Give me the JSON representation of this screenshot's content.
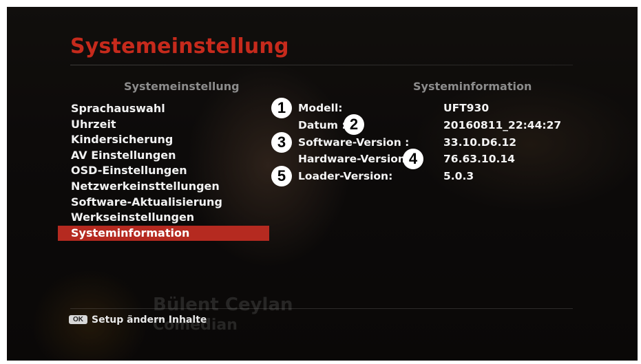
{
  "screen": {
    "title": "Systemeinstellung",
    "menu_header": "Systemeinstellung",
    "info_header": "Systeminformation"
  },
  "menu": {
    "items": [
      {
        "label": "Sprachauswahl"
      },
      {
        "label": "Uhrzeit"
      },
      {
        "label": "Kindersicherung"
      },
      {
        "label": "AV Einstellungen"
      },
      {
        "label": "OSD-Einstellungen"
      },
      {
        "label": "Netzwerkeinsttellungen"
      },
      {
        "label": "Software-Aktualisierung"
      },
      {
        "label": "Werkseinstellungen"
      },
      {
        "label": "Systeminformation",
        "selected": true
      }
    ]
  },
  "info": {
    "rows": [
      {
        "label": "Modell:",
        "value": "UFT930"
      },
      {
        "label": "Datum :",
        "value": "20160811_22:44:27"
      },
      {
        "label": "Software-Version :",
        "value": "33.10.D6.12"
      },
      {
        "label": "Hardware-Version:",
        "value": "76.63.10.14"
      },
      {
        "label": "Loader-Version:",
        "value": "5.0.3"
      }
    ]
  },
  "badges": [
    "1",
    "2",
    "3",
    "4",
    "5"
  ],
  "footer": {
    "key": "OK",
    "text": "Setup ändern Inhalte"
  },
  "background_overlay": {
    "name_line": "Bülent Ceylan",
    "sub_line": "Comedian"
  },
  "colors": {
    "title": "#c62a1c",
    "selection": "#b52a20",
    "text": "#f2f2f2",
    "header": "#8c8c8c"
  }
}
